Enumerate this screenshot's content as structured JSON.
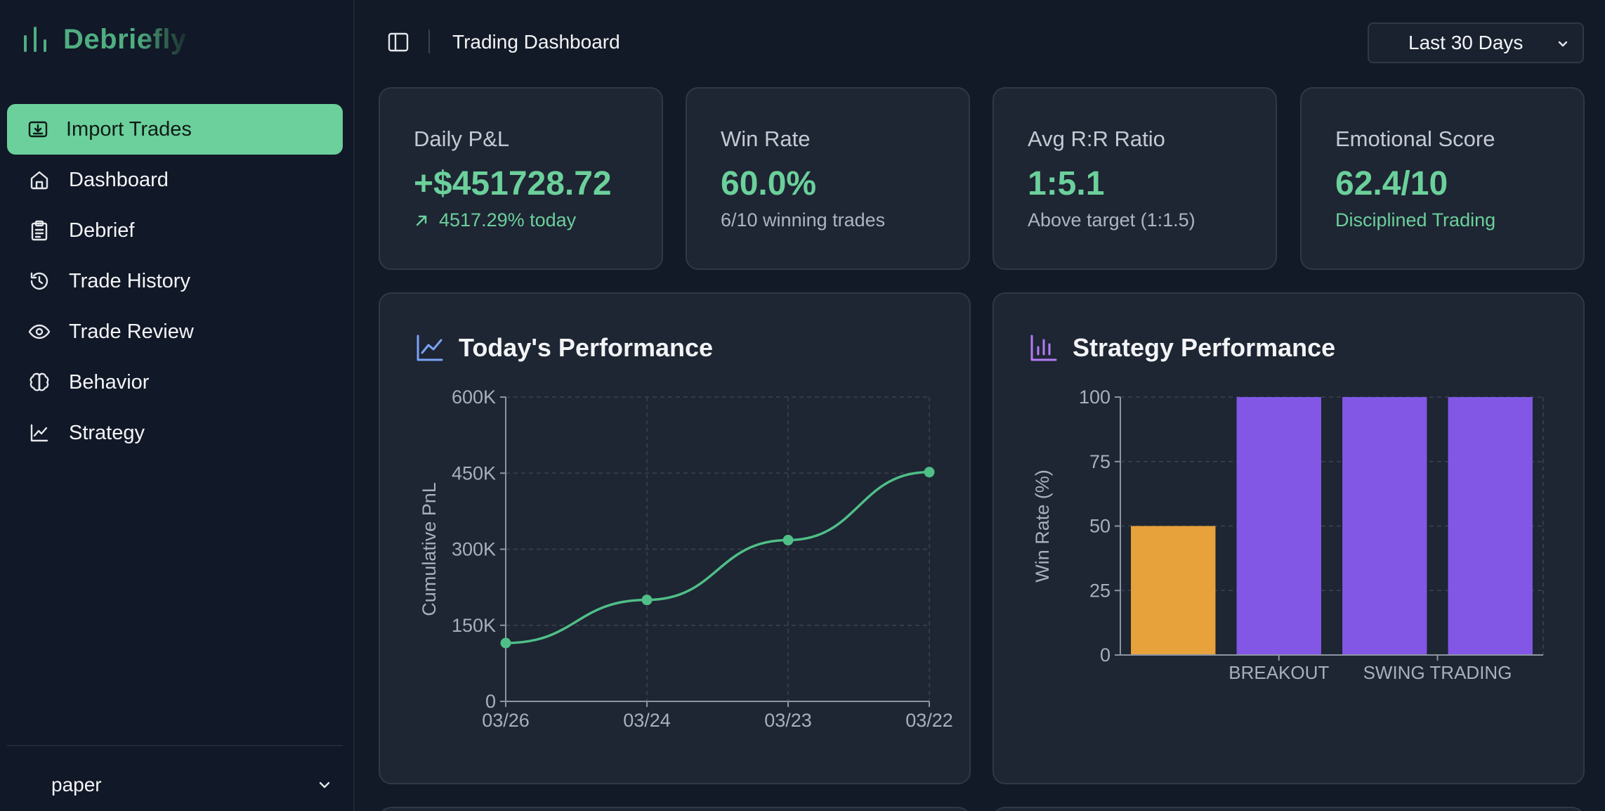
{
  "brand": {
    "name": "Debriefly",
    "icon": "bar-chart-icon",
    "color": "#4fae82"
  },
  "sidebar": {
    "items": [
      {
        "label": "Import Trades",
        "icon": "import-icon",
        "active": true
      },
      {
        "label": "Dashboard",
        "icon": "home-icon",
        "active": false
      },
      {
        "label": "Debrief",
        "icon": "clipboard-icon",
        "active": false
      },
      {
        "label": "Trade History",
        "icon": "history-icon",
        "active": false
      },
      {
        "label": "Trade Review",
        "icon": "eye-icon",
        "active": false
      },
      {
        "label": "Behavior",
        "icon": "brain-icon",
        "active": false
      },
      {
        "label": "Strategy",
        "icon": "line-chart-icon",
        "active": false
      }
    ],
    "account": {
      "value": "paper"
    }
  },
  "header": {
    "title": "Trading Dashboard",
    "range": {
      "value": "Last 30 Days"
    }
  },
  "stats": [
    {
      "label": "Daily P&L",
      "value": "+$451728.72",
      "sub": "4517.29% today",
      "sub_icon": "arrow-up-right-icon"
    },
    {
      "label": "Win Rate",
      "value": "60.0%",
      "sub": "6/10 winning trades"
    },
    {
      "label": "Avg R:R Ratio",
      "value": "1:5.1",
      "sub": "Above target (1:1.5)"
    },
    {
      "label": "Emotional Score",
      "value": "62.4/10",
      "sub": "Disciplined Trading"
    }
  ],
  "colors": {
    "accent": "#6bd09b",
    "line": "#4fbf87",
    "bar_orange": "#e8a23b",
    "bar_purple": "#8257e6",
    "perf_icon": "#7aa2f7",
    "strategy_icon": "#b47cf5"
  },
  "chart_data": [
    {
      "type": "line",
      "title": "Today's Performance",
      "ylabel": "Cumulative PnL",
      "x": [
        "03/26",
        "03/24",
        "03/23",
        "03/22"
      ],
      "values": [
        115000,
        200000,
        318000,
        452000
      ],
      "ylim": [
        0,
        600000
      ],
      "yticks": [
        {
          "value": 0,
          "label": "0"
        },
        {
          "value": 150000,
          "label": "150K"
        },
        {
          "value": 300000,
          "label": "300K"
        },
        {
          "value": 450000,
          "label": "450K"
        },
        {
          "value": 600000,
          "label": "600K"
        }
      ],
      "grid": true
    },
    {
      "type": "bar",
      "title": "Strategy Performance",
      "ylabel": "Win Rate (%)",
      "categories": [
        "",
        "BREAKOUT",
        "",
        "SWING TRADING"
      ],
      "values": [
        50,
        100,
        100,
        100
      ],
      "bar_colors": [
        "#e8a23b",
        "#8257e6",
        "#8257e6",
        "#8257e6"
      ],
      "ylim": [
        0,
        100
      ],
      "yticks": [
        0,
        25,
        50,
        75,
        100
      ],
      "xtick_labels": [
        {
          "label": "BREAKOUT",
          "between": [
            1,
            1
          ]
        },
        {
          "label": "SWING TRADING",
          "between": [
            2,
            3
          ]
        }
      ],
      "grid": true
    }
  ]
}
